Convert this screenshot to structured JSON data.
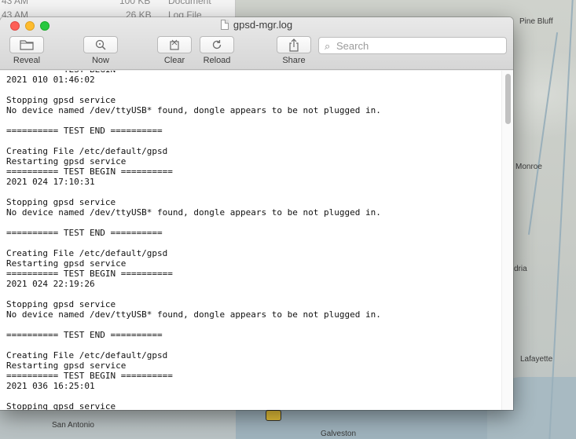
{
  "background": {
    "finder_rows": [
      {
        "time": "43 AM",
        "size": "100 KB",
        "kind": "Document"
      },
      {
        "time": "43 AM",
        "size": "26 KB",
        "kind": "Log File"
      }
    ],
    "map_labels": {
      "pine_bluff": "Pine Bluff",
      "monroe": "Monroe",
      "alexandria_partial": "dria",
      "lafayette": "Lafayette",
      "san_antonio": "San Antonio",
      "galveston": "Galveston"
    }
  },
  "window": {
    "title": "gpsd-mgr.log"
  },
  "toolbar": {
    "reveal_label": "Reveal",
    "now_label": "Now",
    "clear_label": "Clear",
    "reload_label": "Reload",
    "share_label": "Share"
  },
  "search": {
    "placeholder": "Search",
    "value": ""
  },
  "log_lines": [
    "========== TEST BEGIN ==========",
    "2021 010 01:46:02",
    "",
    "Stopping gpsd service",
    "No device named /dev/ttyUSB* found, dongle appears to be not plugged in.",
    "",
    "========== TEST END ==========",
    "",
    "Creating File /etc/default/gpsd",
    "Restarting gpsd service",
    "========== TEST BEGIN ==========",
    "2021 024 17:10:31",
    "",
    "Stopping gpsd service",
    "No device named /dev/ttyUSB* found, dongle appears to be not plugged in.",
    "",
    "========== TEST END ==========",
    "",
    "Creating File /etc/default/gpsd",
    "Restarting gpsd service",
    "========== TEST BEGIN ==========",
    "2021 024 22:19:26",
    "",
    "Stopping gpsd service",
    "No device named /dev/ttyUSB* found, dongle appears to be not plugged in.",
    "",
    "========== TEST END ==========",
    "",
    "Creating File /etc/default/gpsd",
    "Restarting gpsd service",
    "========== TEST BEGIN ==========",
    "2021 036 16:25:01",
    "",
    "Stopping gpsd service"
  ]
}
